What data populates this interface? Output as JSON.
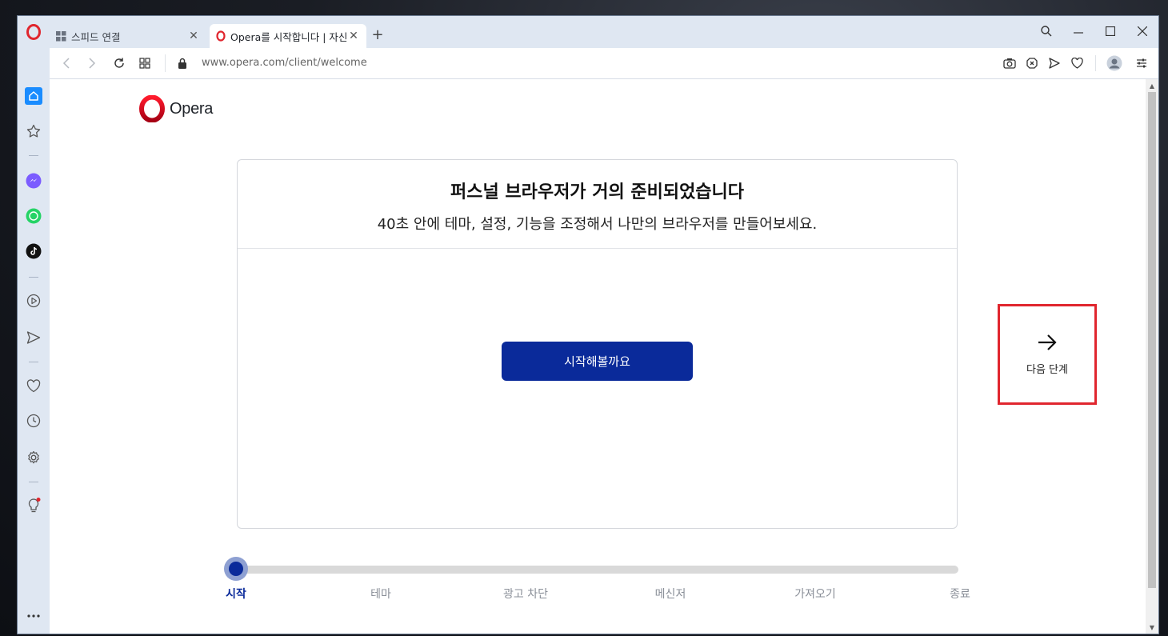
{
  "tabs": [
    {
      "title": "스피드 연결",
      "active": false,
      "icon": "grid-icon"
    },
    {
      "title": "Opera를 시작합니다 | 자신",
      "active": true,
      "icon": "opera-icon"
    }
  ],
  "address": {
    "url": "www.opera.com/client/welcome"
  },
  "brand": {
    "name": "Opera",
    "color": "#e0262e"
  },
  "card": {
    "title": "퍼스널 브라우저가 거의 준비되었습니다",
    "subtitle": "40초 안에 테마, 설정, 기능을 조정해서 나만의 브라우저를 만들어보세요.",
    "start_label": "시작해볼까요"
  },
  "next": {
    "label": "다음 단계",
    "icon": "arrow-right-icon"
  },
  "steps": [
    {
      "label": "시작",
      "current": true
    },
    {
      "label": "테마",
      "current": false
    },
    {
      "label": "광고 차단",
      "current": false
    },
    {
      "label": "메신저",
      "current": false
    },
    {
      "label": "가져오기",
      "current": false
    },
    {
      "label": "종료",
      "current": false
    }
  ],
  "colors": {
    "accent": "#0a2a9a",
    "highlight": "#e0262e",
    "sidebar_bg": "#dfe7f2"
  }
}
